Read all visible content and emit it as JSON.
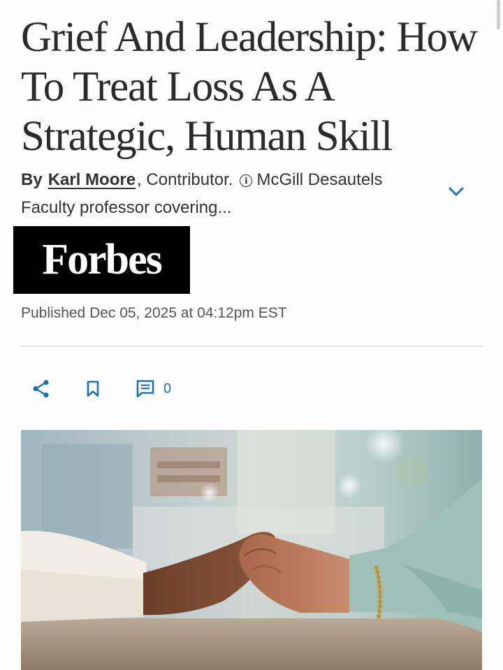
{
  "article": {
    "headline": "Grief And Leadership: How To Treat Loss As A Strategic, Human Skill",
    "byline": {
      "by": "By",
      "author": "Karl Moore",
      "role": ", Contributor.",
      "bio": "McGill Desautels Faculty professor covering..."
    },
    "publication_logo": "Forbes",
    "published": "Published Dec 05, 2025 at 04:12pm EST"
  },
  "actions": {
    "comment_count": "0"
  },
  "icons": {
    "info": "info-icon",
    "expand": "chevron-down-icon",
    "share": "share-icon",
    "bookmark": "bookmark-icon",
    "comment": "comment-icon"
  },
  "colors": {
    "accent": "#1b73b5",
    "logo_bg": "#000000",
    "headline": "#2b2b2b"
  }
}
